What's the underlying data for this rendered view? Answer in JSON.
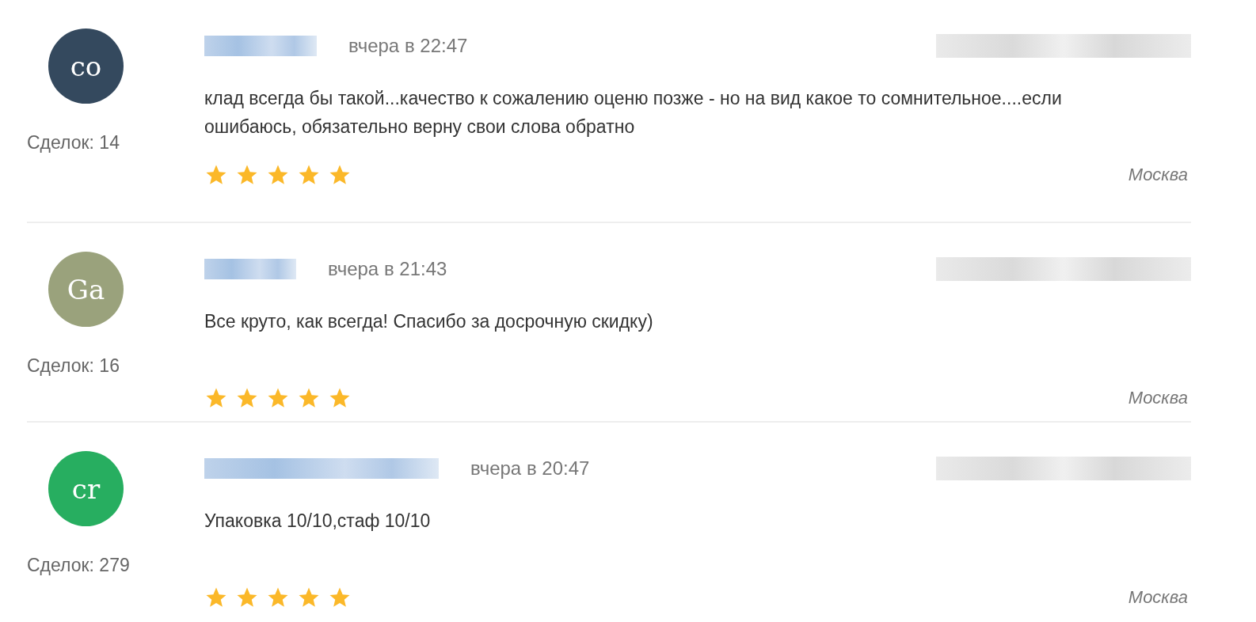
{
  "reviews": [
    {
      "avatar": {
        "initials": "co",
        "color": "#34495e"
      },
      "deals": "Сделок: 14",
      "time": "вчера в 22:47",
      "text": "клад всегда бы такой...качество к сожалению оценю позже - но на вид какое то сомнительное....если ошибаюсь, обязательно верну свои слова обратно",
      "stars": 5,
      "city": "Москва"
    },
    {
      "avatar": {
        "initials": "Ga",
        "color": "#9aa27c"
      },
      "deals": "Сделок: 16",
      "time": "вчера в 21:43",
      "text": "Все круто, как всегда! Спасибо за досрочную скидку)",
      "stars": 5,
      "city": "Москва"
    },
    {
      "avatar": {
        "initials": "cr",
        "color": "#27ae60"
      },
      "deals": "Сделок: 279",
      "time": "вчера в 20:47",
      "text": "Упаковка 10/10,стаф 10/10",
      "stars": 5,
      "city": "Москва"
    }
  ]
}
